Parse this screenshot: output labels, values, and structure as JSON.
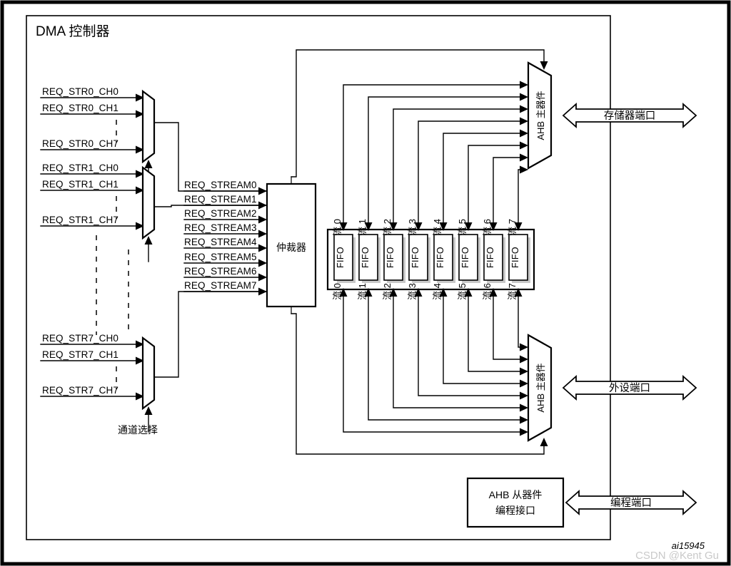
{
  "figure": {
    "title": "DMA 控制器",
    "figure_id": "ai15945",
    "watermark": "CSDN @Kent Gu"
  },
  "channel_select": {
    "label": "通道选择"
  },
  "request_groups": [
    {
      "group": "stream0",
      "signals": [
        "REQ_STR0_CH0",
        "REQ_STR0_CH1",
        "REQ_STR0_CH7"
      ]
    },
    {
      "group": "stream1",
      "signals": [
        "REQ_STR1_CH0",
        "REQ_STR1_CH1",
        "REQ_STR1_CH7"
      ]
    },
    {
      "group": "stream7",
      "signals": [
        "REQ_STR7_CH0",
        "REQ_STR7_CH1",
        "REQ_STR7_CH7"
      ]
    }
  ],
  "stream_requests": [
    "REQ_STREAM0",
    "REQ_STREAM1",
    "REQ_STREAM2",
    "REQ_STREAM3",
    "REQ_STREAM4",
    "REQ_STREAM5",
    "REQ_STREAM6",
    "REQ_STREAM7"
  ],
  "arbiter": {
    "label": "仲裁器"
  },
  "fifo_bank": {
    "fifo_label": "FIFO",
    "count": 8,
    "stream_labels_top": [
      "流 0",
      "流 1",
      "流 2",
      "流 3",
      "流 4",
      "流 5",
      "流 6",
      "流 7"
    ],
    "stream_labels_bottom": [
      "流 0",
      "流 1",
      "流 2",
      "流 3",
      "流 4",
      "流 5",
      "流 6",
      "流 7"
    ]
  },
  "masters": [
    {
      "id": "memory-master",
      "label": "AHB 主器件",
      "port_label": "存储器端口"
    },
    {
      "id": "peripheral-master",
      "label": "AHB 主器件",
      "port_label": "外设端口"
    }
  ],
  "slave": {
    "label_line1": "AHB 从器件",
    "label_line2": "编程接口",
    "port_label": "编程端口"
  },
  "colors": {
    "line": "#000000",
    "background": "#ffffff",
    "watermark": "#c9c9c9",
    "shadow": "#9a9a9a"
  }
}
